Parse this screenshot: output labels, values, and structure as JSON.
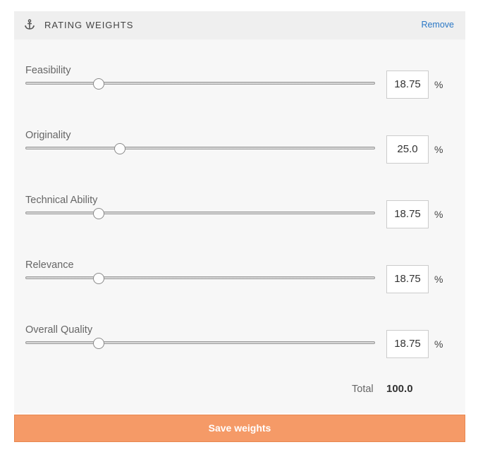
{
  "header": {
    "icon": "anchor-icon",
    "title": "RATING WEIGHTS",
    "remove_label": "Remove"
  },
  "criteria": [
    {
      "label": "Feasibility",
      "value": "18.75",
      "unit": "%",
      "slider_fraction": 0.21
    },
    {
      "label": "Originality",
      "value": "25.0",
      "unit": "%",
      "slider_fraction": 0.27
    },
    {
      "label": "Technical Ability",
      "value": "18.75",
      "unit": "%",
      "slider_fraction": 0.21
    },
    {
      "label": "Relevance",
      "value": "18.75",
      "unit": "%",
      "slider_fraction": 0.21
    },
    {
      "label": "Overall Quality",
      "value": "18.75",
      "unit": "%",
      "slider_fraction": 0.21
    }
  ],
  "total": {
    "label": "Total",
    "value": "100.0"
  },
  "save_label": "Save weights",
  "colors": {
    "accent_button": "#f59a67",
    "link": "#2a77c5",
    "panel_bg": "#f7f7f7",
    "header_bg": "#efefef"
  }
}
